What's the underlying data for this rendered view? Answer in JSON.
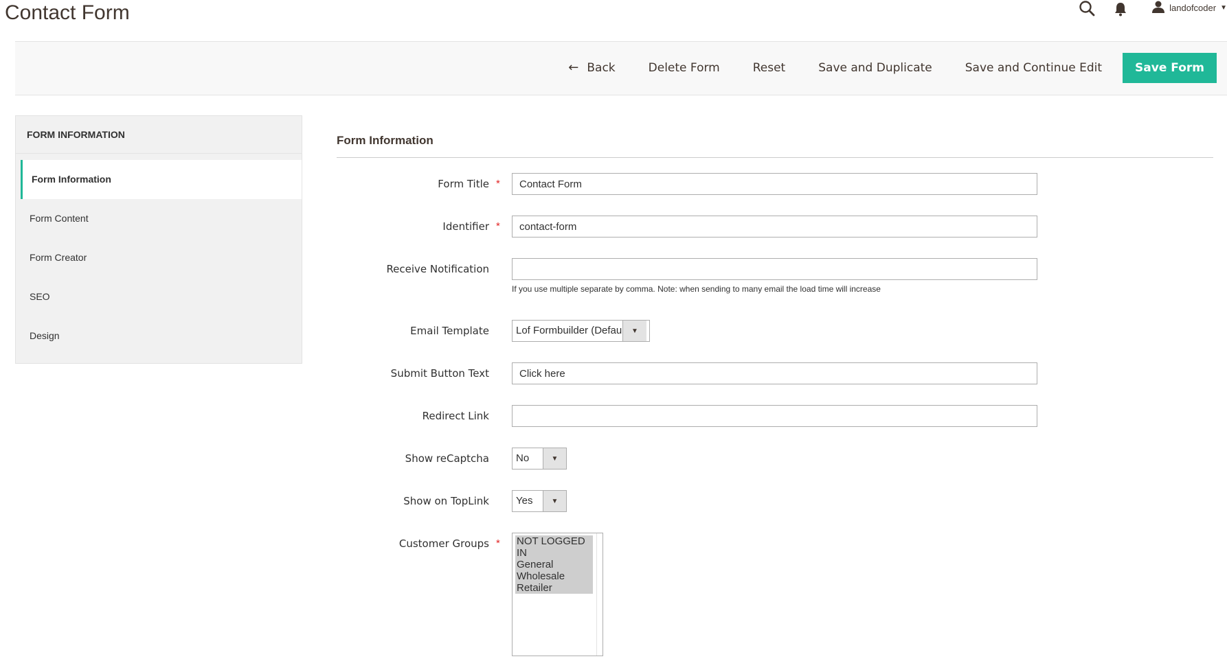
{
  "page": {
    "title": "Contact Form"
  },
  "header": {
    "user_name": "landofcoder"
  },
  "actions": {
    "back": "Back",
    "delete": "Delete Form",
    "reset": "Reset",
    "save_duplicate": "Save and Duplicate",
    "save_continue": "Save and Continue Edit",
    "save": "Save Form"
  },
  "sidebar": {
    "title": "FORM INFORMATION",
    "items": [
      {
        "label": "Form Information",
        "active": true
      },
      {
        "label": "Form Content"
      },
      {
        "label": "Form Creator"
      },
      {
        "label": "SEO"
      },
      {
        "label": "Design"
      }
    ]
  },
  "section": {
    "title": "Form Information"
  },
  "fields": {
    "form_title": {
      "label": "Form Title",
      "value": "Contact Form",
      "required": true
    },
    "identifier": {
      "label": "Identifier",
      "value": "contact-form",
      "required": true
    },
    "receive_notification": {
      "label": "Receive Notification",
      "value": "",
      "note": "If you use multiple separate by comma. Note: when sending to many email the load time will increase"
    },
    "email_template": {
      "label": "Email Template",
      "value": "Lof Formbuilder (Defau"
    },
    "submit_button_text": {
      "label": "Submit Button Text",
      "value": "Click here"
    },
    "redirect_link": {
      "label": "Redirect Link",
      "value": ""
    },
    "show_recaptcha": {
      "label": "Show reCaptcha",
      "value": "No"
    },
    "show_on_toplink": {
      "label": "Show on TopLink",
      "value": "Yes"
    },
    "customer_groups": {
      "label": "Customer Groups",
      "required": true,
      "options": [
        "NOT LOGGED IN",
        "General",
        "Wholesale",
        "Retailer"
      ]
    }
  },
  "colors": {
    "accent": "#20b898",
    "required": "#e22626"
  }
}
